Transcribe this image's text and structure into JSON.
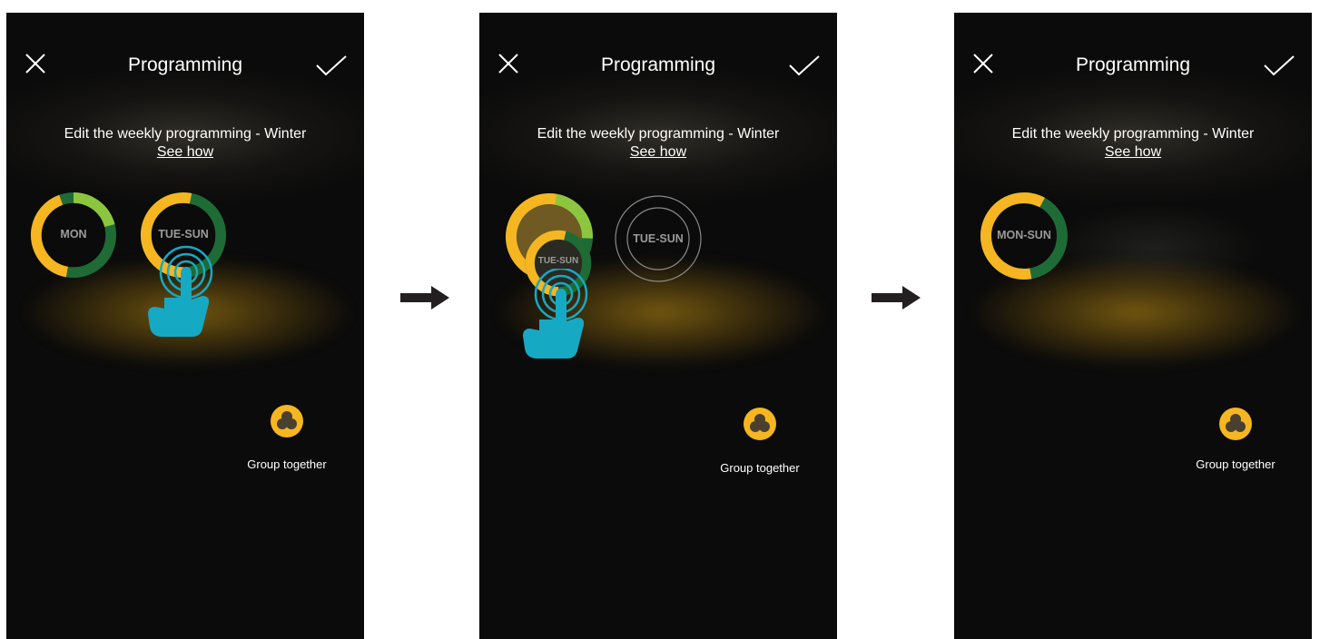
{
  "screens": [
    {
      "header": {
        "title": "Programming",
        "close_icon": "close-icon",
        "confirm_icon": "check-icon"
      },
      "subtitle": "Edit the weekly programming - Winter",
      "help_link": "See how",
      "day_groups": [
        {
          "label": "MON",
          "state": "normal"
        },
        {
          "label": "TUE-SUN",
          "state": "touched"
        }
      ],
      "group_button": {
        "label": "Group together",
        "icon": "group-circles-icon"
      }
    },
    {
      "header": {
        "title": "Programming",
        "close_icon": "close-icon",
        "confirm_icon": "check-icon"
      },
      "subtitle": "Edit the weekly programming - Winter",
      "help_link": "See how",
      "day_groups": [
        {
          "label": "",
          "state": "drop-target"
        },
        {
          "label": "TUE-SUN",
          "state": "dragging"
        },
        {
          "label": "TUE-SUN",
          "state": "ghost"
        }
      ],
      "group_button": {
        "label": "Group together",
        "icon": "group-circles-icon"
      }
    },
    {
      "header": {
        "title": "Programming",
        "close_icon": "close-icon",
        "confirm_icon": "check-icon"
      },
      "subtitle": "Edit the weekly programming - Winter",
      "help_link": "See how",
      "day_groups": [
        {
          "label": "MON-SUN",
          "state": "merged"
        }
      ],
      "group_button": {
        "label": "Group together",
        "icon": "group-circles-icon"
      }
    }
  ],
  "colors": {
    "yellow": "#f5b621",
    "dark_green": "#1f6b36",
    "light_green": "#8cc63f",
    "hand": "#16a9c4",
    "background": "#0b0b0b"
  }
}
